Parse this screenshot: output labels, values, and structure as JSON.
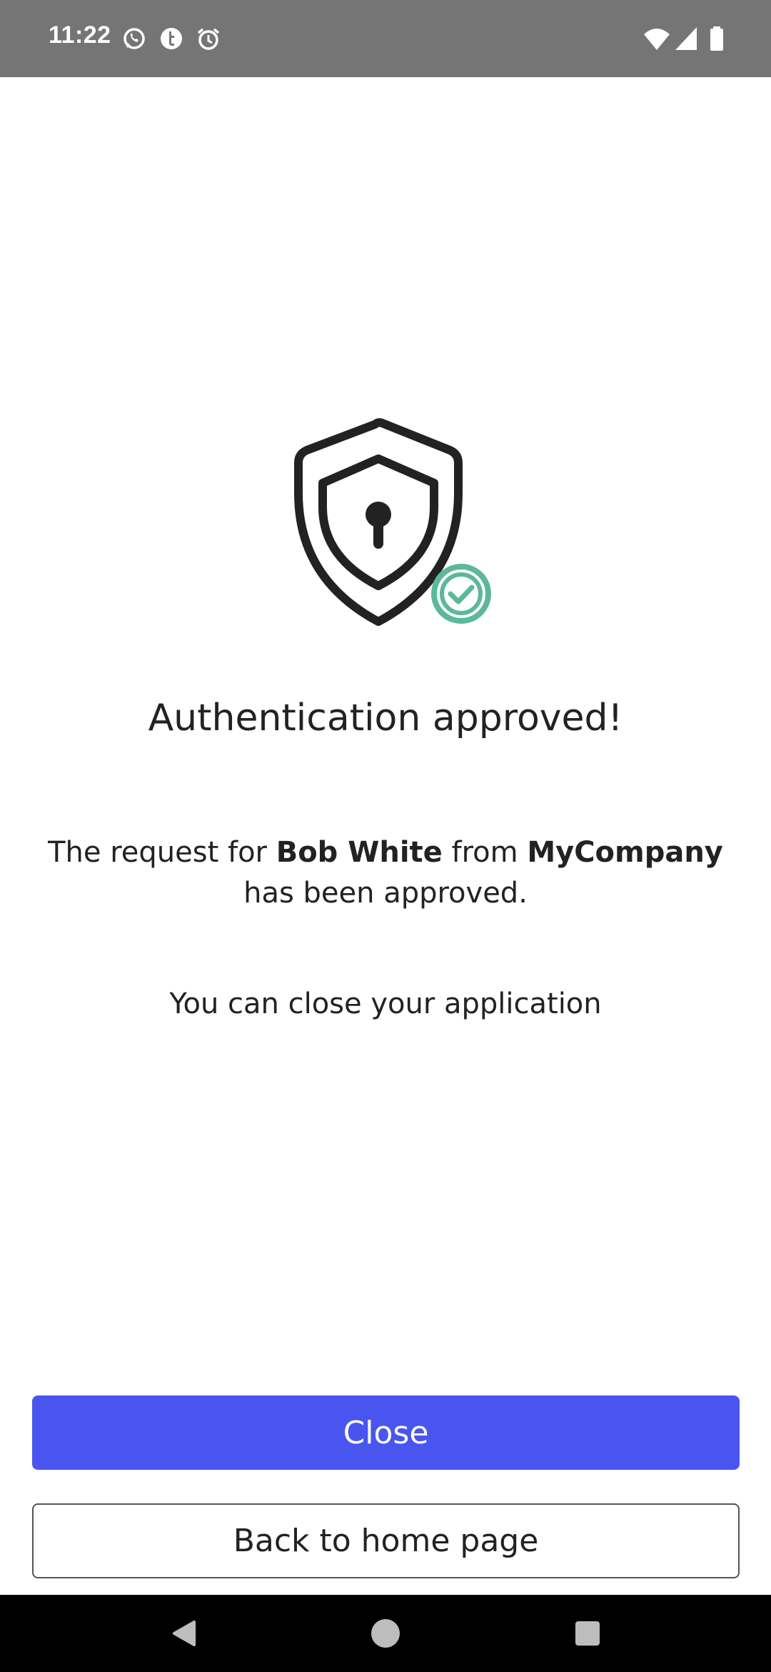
{
  "status_bar": {
    "time": "11:22",
    "left_icons": [
      "whatsapp-icon",
      "t-app-icon",
      "alarm-icon"
    ],
    "right_icons": [
      "wifi-icon",
      "cellular-signal-icon",
      "battery-icon"
    ]
  },
  "hero": {
    "icon": "shield-lock-icon",
    "badge_icon": "check-circle-icon",
    "badge_color": "#5cb89a"
  },
  "main": {
    "title": "Authentication approved!",
    "message_prefix": "The request for ",
    "user_name": "Bob White",
    "message_middle": " from ",
    "company": "MyCompany",
    "message_suffix": " has been approved.",
    "hint": "You can close your application"
  },
  "actions": {
    "close_label": "Close",
    "back_label": "Back to home page",
    "primary_color": "#4a55f0"
  },
  "nav_bar": {
    "icons": [
      "back-triangle-icon",
      "home-circle-icon",
      "recents-square-icon"
    ]
  }
}
